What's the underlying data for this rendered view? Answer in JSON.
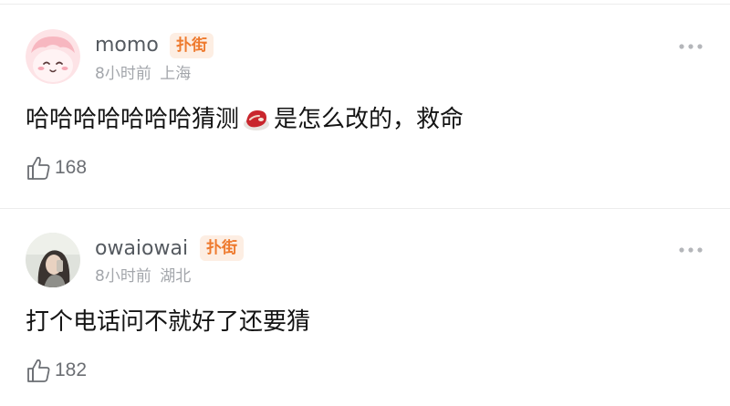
{
  "comments": [
    {
      "username": "momo",
      "badge": "扑街",
      "time": "8小时前",
      "location": "上海",
      "text_before": "哈哈哈哈哈哈哈猜测",
      "inline_emoji": "steak-emoji",
      "text_after": "是怎么改的，救命",
      "likes": "168"
    },
    {
      "username": "owaiowai",
      "badge": "扑街",
      "time": "8小时前",
      "location": "湖北",
      "text": "打个电话问不就好了还要猜",
      "likes": "182"
    }
  ],
  "icons": {
    "like": "thumbs-up-icon",
    "more": "more-dots-icon"
  },
  "colors": {
    "badge_bg": "#fdeee3",
    "badge_text": "#ee7a2e",
    "meta_text": "#a3a6ab",
    "username_text": "#555a60"
  }
}
